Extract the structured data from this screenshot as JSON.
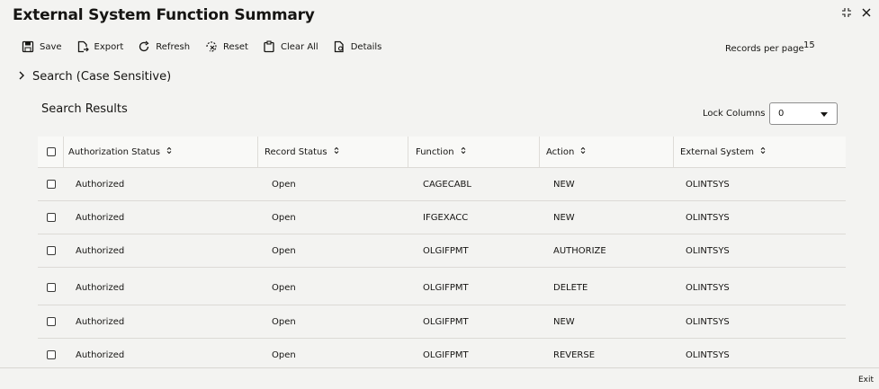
{
  "app": {
    "title": "External System Function Summary"
  },
  "toolbar": {
    "save": "Save",
    "export": "Export",
    "refresh": "Refresh",
    "reset": "Reset",
    "clear_all": "Clear All",
    "details": "Details",
    "records_per_page_label": "Records per page",
    "records_per_page_value": "15"
  },
  "search": {
    "toggle_label": "Search (Case Sensitive)"
  },
  "results": {
    "title": "Search Results",
    "lock_columns_label": "Lock Columns",
    "lock_columns_value": "0",
    "columns": [
      "Authorization Status",
      "Record Status",
      "Function",
      "Action",
      "External System"
    ],
    "rows": [
      [
        "Authorized",
        "Open",
        "CAGECABL",
        "NEW",
        "OLINTSYS"
      ],
      [
        "Authorized",
        "Open",
        "IFGEXACC",
        "NEW",
        "OLINTSYS"
      ],
      [
        "Authorized",
        "Open",
        "OLGIFPMT",
        "AUTHORIZE",
        "OLINTSYS"
      ],
      [
        "Authorized",
        "Open",
        "OLGIFPMT",
        "DELETE",
        "OLINTSYS"
      ],
      [
        "Authorized",
        "Open",
        "OLGIFPMT",
        "NEW",
        "OLINTSYS"
      ],
      [
        "Authorized",
        "Open",
        "OLGIFPMT",
        "REVERSE",
        "OLINTSYS"
      ]
    ]
  },
  "footer": {
    "exit": "Exit"
  }
}
